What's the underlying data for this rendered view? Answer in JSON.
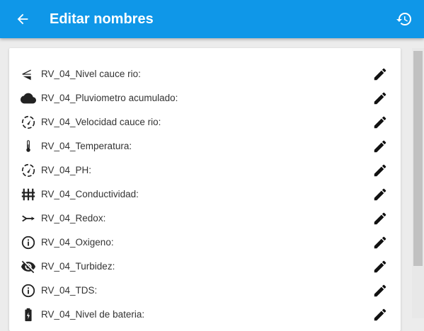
{
  "appbar": {
    "title": "Editar nombres",
    "back_icon": "arrow-back-icon",
    "restore_icon": "restore-icon",
    "color": "#0f97e8"
  },
  "sensors": [
    {
      "label": "RV_04_Nivel cauce rio:",
      "icon": "water-level-icon"
    },
    {
      "label": "RV_04_Pluviometro acumulado:",
      "icon": "cloud-icon"
    },
    {
      "label": "RV_04_Velocidad cauce rio:",
      "icon": "speed-gauge-icon"
    },
    {
      "label": "RV_04_Temperatura:",
      "icon": "thermometer-icon"
    },
    {
      "label": "RV_04_PH:",
      "icon": "gauge-icon"
    },
    {
      "label": "RV_04_Conductividad:",
      "icon": "conductivity-icon"
    },
    {
      "label": "RV_04_Redox:",
      "icon": "redox-arrow-icon"
    },
    {
      "label": "RV_04_Oxigeno:",
      "icon": "info-icon"
    },
    {
      "label": "RV_04_Turbidez:",
      "icon": "visibility-off-icon"
    },
    {
      "label": "RV_04_TDS:",
      "icon": "info-icon"
    },
    {
      "label": "RV_04_Nivel de bateria:",
      "icon": "battery-icon"
    }
  ],
  "edit_icon": "pencil-edit-icon"
}
